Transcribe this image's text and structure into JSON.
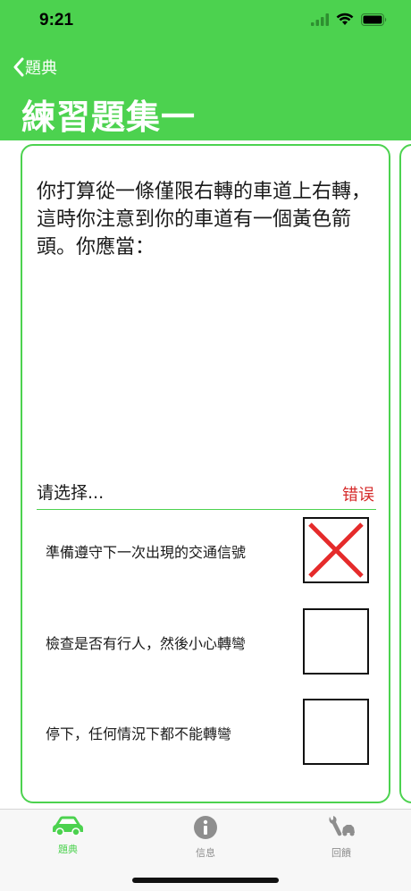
{
  "status": {
    "time": "9:21"
  },
  "nav": {
    "back_label": "題典",
    "title": "練習題集一"
  },
  "question": {
    "text": "你打算從一條僅限右轉的車道上右轉，這時你注意到你的車道有一個黃色箭頭。你應當："
  },
  "answer": {
    "prompt": "请选择...",
    "result": "错误"
  },
  "options": [
    {
      "text": "準備遵守下一次出現的交通信號",
      "state": "wrong"
    },
    {
      "text": "檢查是否有行人，然後小心轉彎",
      "state": "empty"
    },
    {
      "text": "停下，任何情況下都不能轉彎",
      "state": "empty"
    }
  ],
  "tabs": [
    {
      "label": "題典",
      "icon": "car-icon",
      "active": true
    },
    {
      "label": "信息",
      "icon": "info-icon",
      "active": false
    },
    {
      "label": "回饋",
      "icon": "tools-icon",
      "active": false
    }
  ],
  "colors": {
    "accent": "#4cd24f",
    "wrong": "#e52b2b",
    "result_text": "#d62b2b",
    "inactive_tab": "#8e8e8e"
  }
}
